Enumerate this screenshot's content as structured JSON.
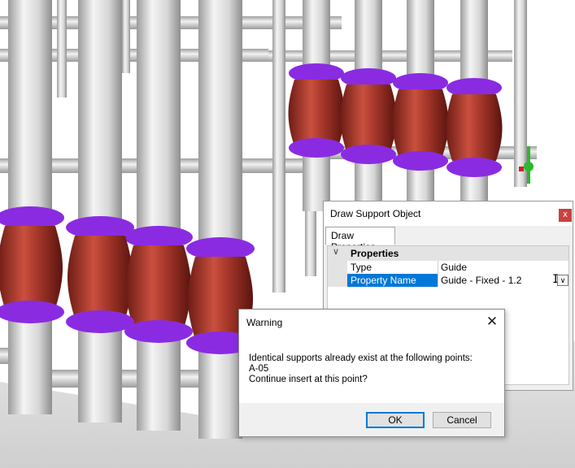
{
  "draw_support": {
    "title": "Draw Support Object",
    "close_glyph": "x",
    "tab": "Draw Properties",
    "category": "Properties",
    "rows": [
      {
        "name": "Type",
        "value": "Guide"
      },
      {
        "name": "Property Name",
        "value": "Guide - Fixed - 1.2"
      }
    ]
  },
  "warning": {
    "title": "Warning",
    "close_glyph": "✕",
    "lines": [
      "Identical supports already exist at the following points:",
      "A-05",
      "Continue insert at this point?"
    ],
    "ok_label": "OK",
    "cancel_label": "Cancel"
  },
  "colors": {
    "pipe": "#d9d9d9",
    "flange": "#8a2be2",
    "bellows": "#a8382b",
    "selection": "#0078d7",
    "close_button": "#c9413d"
  }
}
